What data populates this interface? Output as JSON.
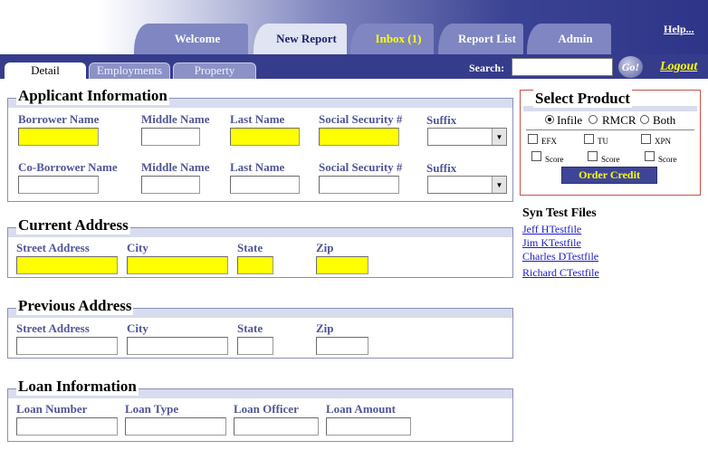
{
  "nav": {
    "tabs": [
      {
        "label": "Welcome"
      },
      {
        "label": "New Report"
      },
      {
        "label": "Inbox (1)"
      },
      {
        "label": "Report List"
      },
      {
        "label": "Admin"
      }
    ],
    "help_label": "Help..."
  },
  "subnav": {
    "tabs": [
      {
        "label": "Detail"
      },
      {
        "label": "Employments"
      },
      {
        "label": "Property"
      }
    ],
    "search_label": "Search:",
    "search_value": "",
    "go_label": "Go!",
    "logout_label": "Logout"
  },
  "applicant": {
    "title": "Applicant Information",
    "row1": {
      "borrower_name": "Borrower Name",
      "middle_name": "Middle Name",
      "last_name": "Last Name",
      "ssn": "Social Security #",
      "suffix": "Suffix"
    },
    "row2": {
      "co_borrower_name": "Co-Borrower Name",
      "middle_name": "Middle Name",
      "last_name": "Last Name",
      "ssn": "Social Security #",
      "suffix": "Suffix"
    }
  },
  "current_address": {
    "title": "Current Address",
    "street": "Street Address",
    "city": "City",
    "state": "State",
    "zip": "Zip"
  },
  "previous_address": {
    "title": "Previous Address",
    "street": "Street Address",
    "city": "City",
    "state": "State",
    "zip": "Zip"
  },
  "loan": {
    "title": "Loan Information",
    "number": "Loan Number",
    "type": "Loan Type",
    "officer": "Loan Officer",
    "amount": "Loan Amount"
  },
  "product": {
    "title": "Select Product",
    "options": [
      {
        "label": "Infile",
        "selected": true
      },
      {
        "label": "RMCR",
        "selected": false
      },
      {
        "label": "Both",
        "selected": false
      }
    ],
    "bureaus": [
      "EFX",
      "TU",
      "XPN"
    ],
    "score_label": "Score",
    "order_button": "Order Credit"
  },
  "syn_files": {
    "title": "Syn Test Files",
    "links": [
      "Jeff HTestfile",
      "Jim KTestfile",
      "Charles DTestfile",
      "Richard CTestfile"
    ]
  },
  "colors": {
    "nav_bg": "#363c8c",
    "tab_bg": "#7f86c2",
    "label_color": "#4f5599",
    "required_field": "#ffff00",
    "inbox_highlight": "#ffff00",
    "product_border": "#c8504a"
  }
}
